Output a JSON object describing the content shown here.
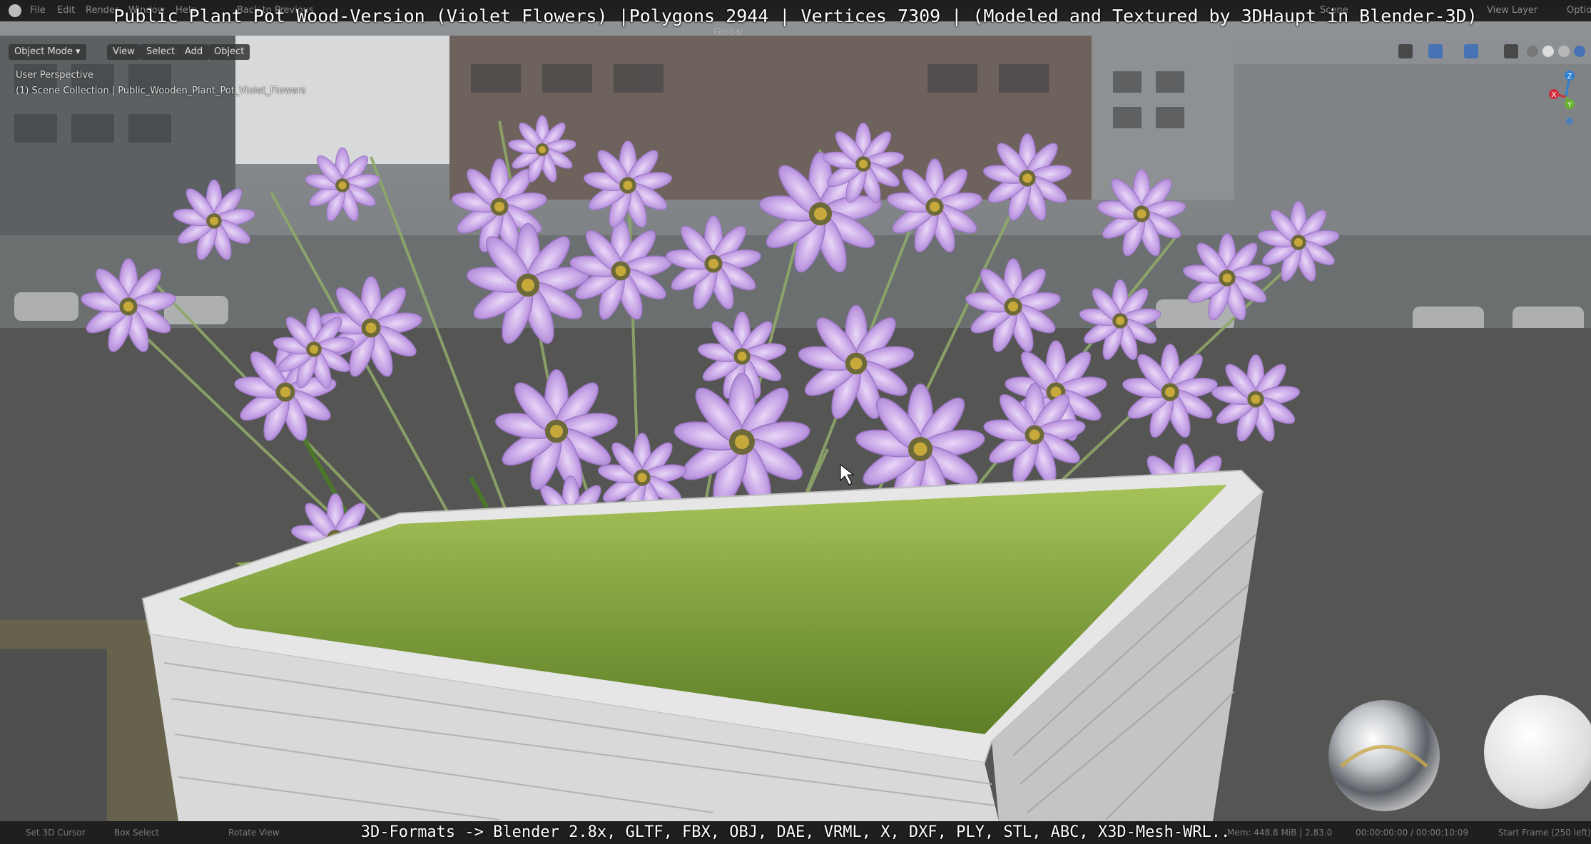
{
  "title_overlay": "Public Plant Pot Wood-Version (Violet Flowers) |Polygons 2944 | Vertices 7309 | (Modeled and Textured by 3DHaupt in Blender-3D)",
  "menu": {
    "file": "File",
    "edit": "Edit",
    "render": "Render",
    "window": "Window",
    "help": "Help",
    "back_to_previous": "Back to Previous",
    "scene": "Scene",
    "view_layer": "View Layer",
    "options": "Optio"
  },
  "toolbar": {
    "transform_orientation": "Global"
  },
  "header": {
    "mode": "Object Mode",
    "view": "View",
    "select": "Select",
    "add": "Add",
    "object": "Object"
  },
  "viewport_info": {
    "perspective": "User Perspective",
    "collection": "(1) Scene Collection | Public_Wooden_Plant_Pot_Violet_Flowers"
  },
  "gizmo": {
    "z": "Z",
    "x": "X",
    "y": "Y"
  },
  "status": {
    "set_cursor": "Set 3D Cursor",
    "box_select": "Box Select",
    "rotate_view": "Rotate View",
    "mem": "Mem: 448.8 MiB | 2.83.0",
    "time": "00:00:00:00 / 00:00:10:09",
    "start_frame": "Start Frame (250 left)"
  },
  "bottom_overlay": "3D-Formats -> Blender 2.8x, GLTF, FBX, OBJ, DAE, VRML, X, DXF, PLY, STL, ABC, X3D-Mesh-WRL..",
  "colors": {
    "petal": "#c9a6e8",
    "petal_dark": "#9a72c8",
    "planter": "#e4e4e4",
    "grass": "#7fa23a",
    "ui_bg": "#232323"
  }
}
